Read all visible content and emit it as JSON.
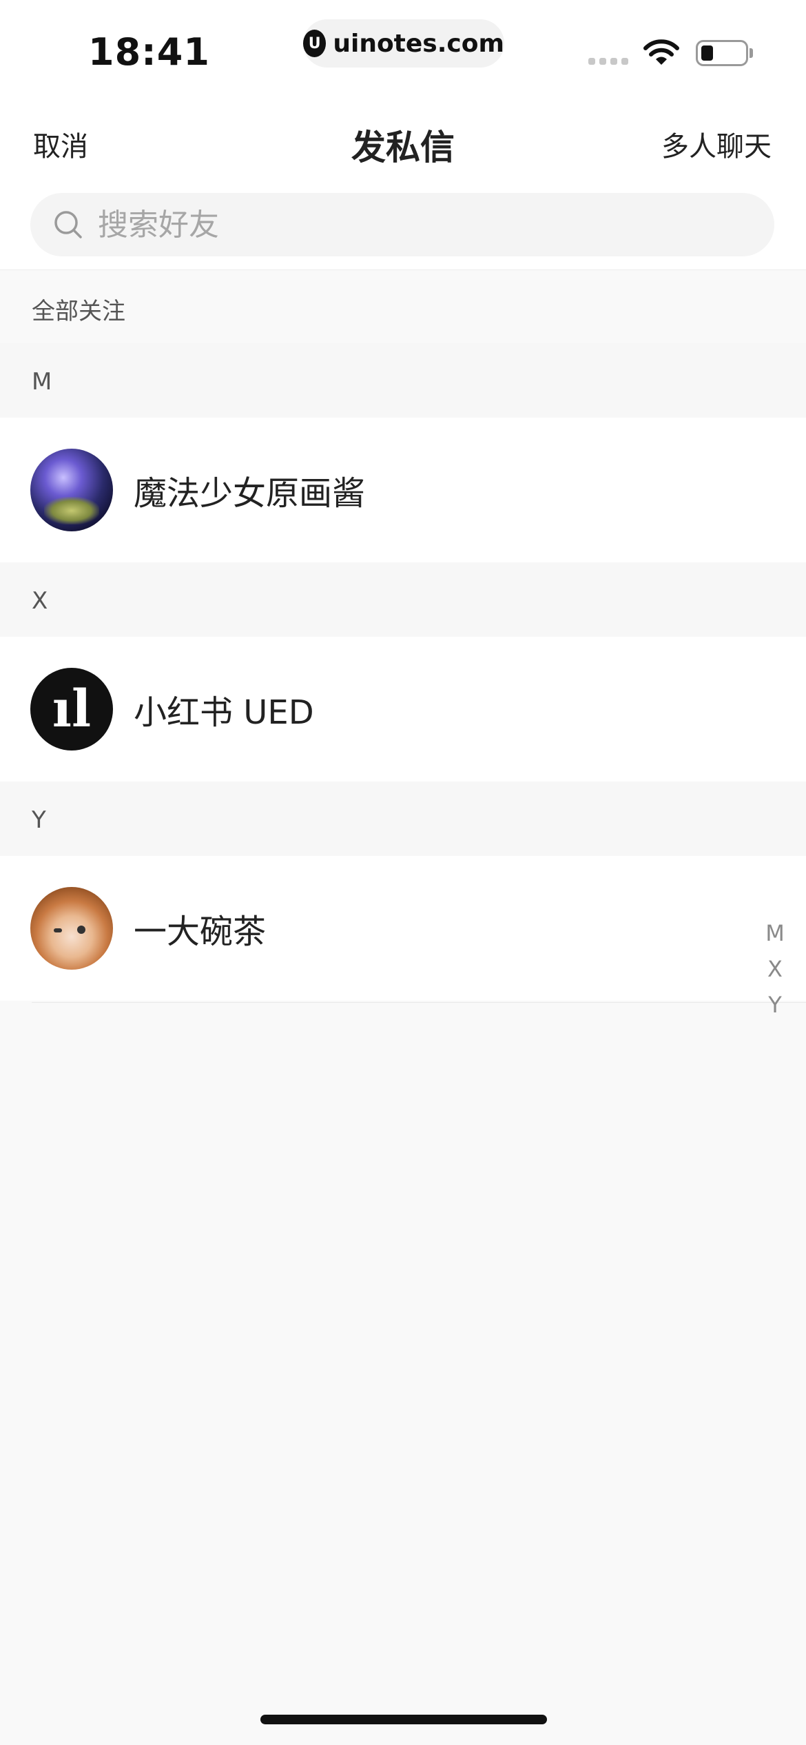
{
  "status_bar": {
    "time": "18:41",
    "url": "uinotes.com",
    "url_logo_glyph": "U"
  },
  "nav": {
    "cancel_label": "取消",
    "title": "发私信",
    "group_chat_label": "多人聊天"
  },
  "search": {
    "placeholder": "搜索好友",
    "value": "",
    "icon": "search-icon"
  },
  "list": {
    "all_follow_label": "全部关注",
    "sections": [
      {
        "letter": "M",
        "contacts": [
          {
            "name": "魔法少女原画酱",
            "avatar": "anime-girl-avatar"
          }
        ]
      },
      {
        "letter": "X",
        "contacts": [
          {
            "name": "小红书 UED",
            "avatar": "ued-logo-avatar",
            "avatar_glyph": "ıl"
          }
        ]
      },
      {
        "letter": "Y",
        "contacts": [
          {
            "name": "一大碗茶",
            "avatar": "chibi-avatar"
          }
        ]
      }
    ]
  },
  "index_bar": [
    "M",
    "X",
    "Y"
  ],
  "colors": {
    "background": "#f9f9f9",
    "surface": "#ffffff",
    "text_primary": "#222222",
    "text_secondary": "#555555",
    "placeholder": "#a6a6a6",
    "index_letter": "#8a8a8a"
  }
}
